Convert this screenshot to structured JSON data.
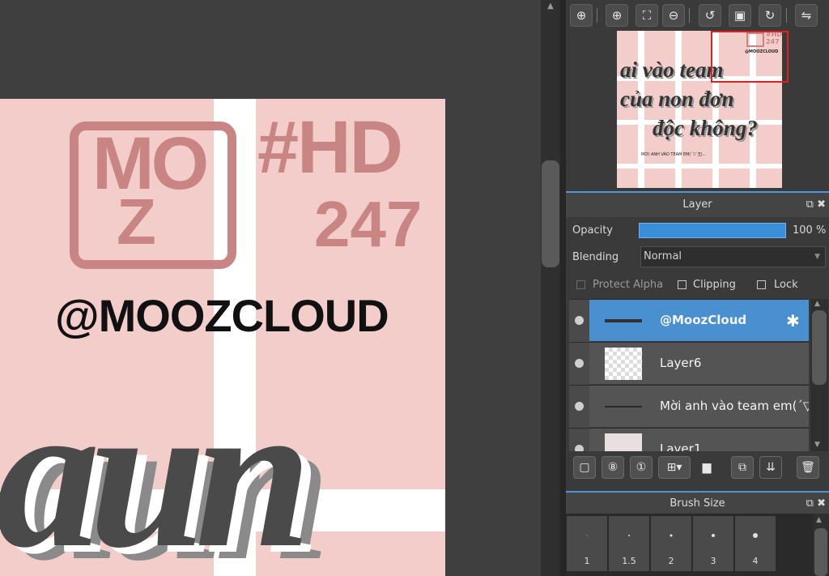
{
  "artwork": {
    "logo_top": "MO",
    "logo_bottom": "Z",
    "hashtag_line1": "#HD",
    "hashtag_line2": "247",
    "handle": "@MOOZCLOUD",
    "big_text": "aun"
  },
  "navigator": {
    "thumb_line1": "ai vào team",
    "thumb_line2": "của non đơn",
    "thumb_line3": "độc không?",
    "thumb_small": "MỜI ANH VÀO TEAM EM(´▽`ʃƪ)...",
    "thumb_tag1": "#HD",
    "thumb_tag2": "247",
    "thumb_handle": "@MOOZCLOUD"
  },
  "toolbar": {
    "icons": [
      "zoom-fit-icon",
      "zoom-in-icon",
      "fit-window-icon",
      "zoom-out-icon",
      "rotate-left-icon",
      "actual-size-icon",
      "rotate-right-icon",
      "flip-icon"
    ]
  },
  "layer_panel": {
    "title": "Layer",
    "opacity_label": "Opacity",
    "opacity_percent": 100,
    "opacity_value": "100 %",
    "blending_label": "Blending",
    "blending_value": "Normal",
    "protect_alpha_label": "Protect Alpha",
    "clipping_label": "Clipping",
    "lock_label": "Lock",
    "layers": [
      {
        "name": "@MoozCloud",
        "selected": true
      },
      {
        "name": "Layer6",
        "selected": false
      },
      {
        "name": "Mời anh vào team em(´▽",
        "selected": false
      },
      {
        "name": "Layer1",
        "selected": false
      }
    ]
  },
  "brush_panel": {
    "title": "Brush Size",
    "sizes": [
      "1",
      "1.5",
      "2",
      "3",
      "4"
    ]
  },
  "colors": {
    "accent": "#4a90d0",
    "canvas_pink": "#f3cdca",
    "logo_rose": "#c98583",
    "selection_red": "#e02020"
  }
}
